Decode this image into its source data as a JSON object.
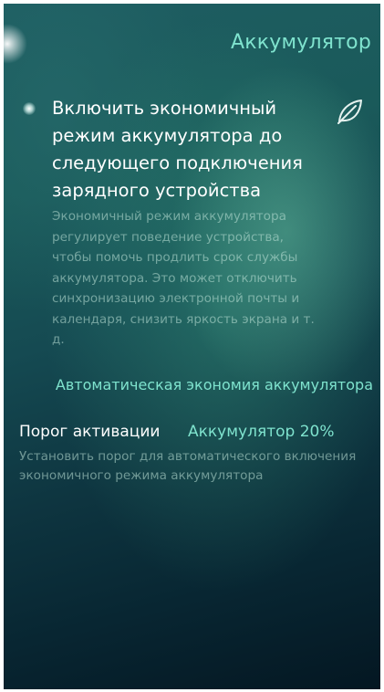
{
  "page": {
    "title": "Аккумулятор"
  },
  "power_saving_toggle": {
    "title": "Включить экономичный режим аккумулятора до следующего подключения зарядного устройства",
    "description": "Экономичный режим аккумулятора регулирует поведение устройства, чтобы помочь продлить срок службы аккумулятора. Это может отключить синхронизацию электронной почты и календаря, снизить яркость экрана и т. д.",
    "enabled": false,
    "icon": "leaf-icon"
  },
  "auto_saving": {
    "section_header": "Автоматическая экономия аккумулятора",
    "threshold_label": "Порог активации",
    "threshold_value": "Аккумулятор 20%",
    "threshold_description": "Установить порог для автоматического включения экономичного режима аккумулятора"
  },
  "colors": {
    "accent": "#7fe3ce",
    "primary_text": "#ffffff",
    "secondary_text": "#9fbfb6"
  }
}
